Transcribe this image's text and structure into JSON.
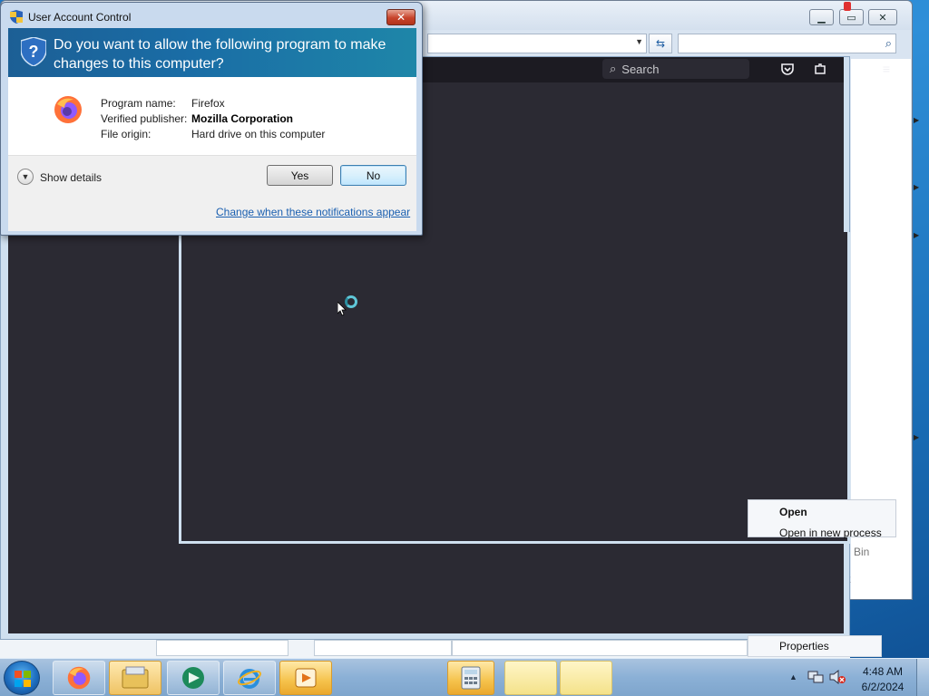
{
  "uac": {
    "title": "User Account Control",
    "question": "Do you want to allow the following program to make changes to this computer?",
    "program_name_label": "Program name:",
    "program_name_value": "Firefox",
    "publisher_label": "Verified publisher:",
    "publisher_value": "Mozilla Corporation",
    "origin_label": "File origin:",
    "origin_value": "Hard drive on this computer",
    "show_details": "Show details",
    "yes_label": "Yes",
    "no_label": "No",
    "change_link": "Change when these notifications appear"
  },
  "firefox": {
    "search_placeholder": "Search"
  },
  "context_menu": {
    "items": [
      "Open",
      "Open in new process"
    ],
    "properties": "Properties"
  },
  "explorer": {
    "bin_label": "Bin",
    "partial_label": "t"
  },
  "taskbar": {
    "time": "4:48 AM",
    "date": "6/2/2024",
    "apps": [
      "firefox-icon",
      "folder-icon",
      "media-center-icon",
      "internet-explorer-icon",
      "media-player-icon",
      "calculator-icon"
    ]
  },
  "colors": {
    "uac_header": "#1c5f95",
    "firefox_bg": "#2b2a33",
    "link": "#1a5fb0",
    "taskbar": "#8bb0d6"
  }
}
